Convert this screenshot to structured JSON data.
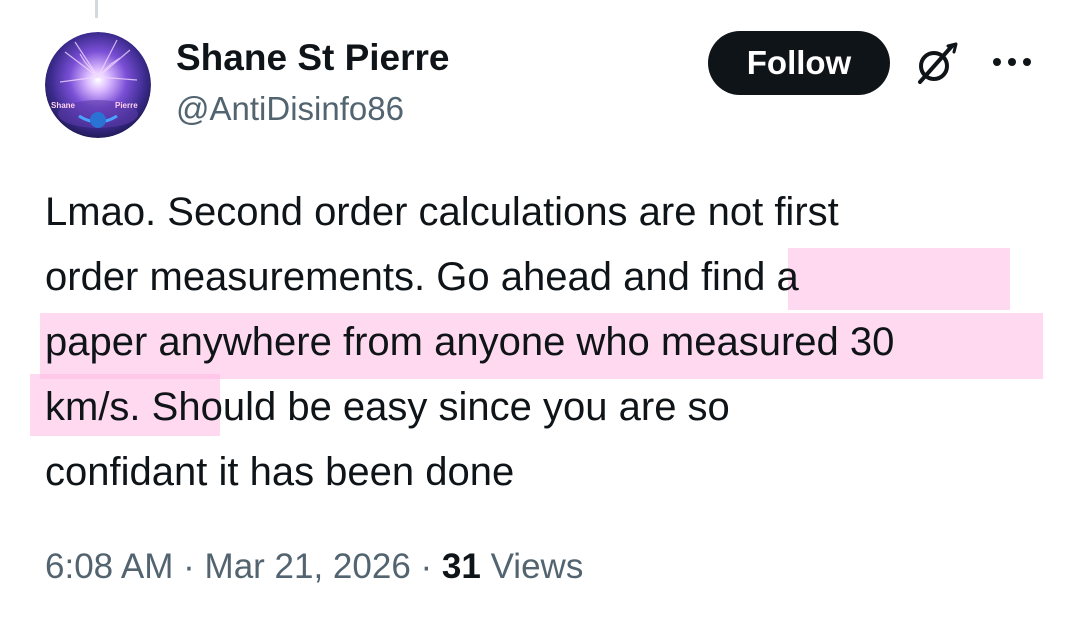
{
  "author": {
    "display_name": "Shane St Pierre",
    "handle": "@AntiDisinfo86",
    "avatar_text_left": "Shane",
    "avatar_text_right": "Pierre"
  },
  "actions": {
    "follow_label": "Follow",
    "grok_icon": "grok-icon",
    "more_icon": "more-options-icon"
  },
  "tweet": {
    "lines": [
      "Lmao.  Second order calculations are not first",
      "order measurements.  Go ahead and find a",
      "paper anywhere from anyone who measured 30",
      "km/s.  Should be easy since you are so",
      "confidant it has been done"
    ]
  },
  "meta": {
    "time": "6:08 AM",
    "separator": "·",
    "date": "Mar 21, 2026",
    "views_count": "31",
    "views_label": "Views"
  },
  "colors": {
    "text": "#0f1419",
    "secondary": "#536471",
    "button_bg": "#0f1419",
    "highlight": "#ffbae2"
  }
}
